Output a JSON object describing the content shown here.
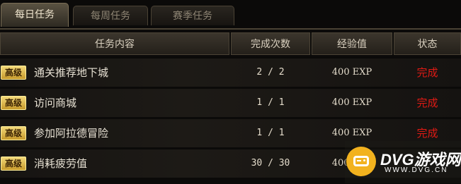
{
  "tabs": [
    {
      "label": "每日任务",
      "active": true
    },
    {
      "label": "每周任务",
      "active": false
    },
    {
      "label": "赛季任务",
      "active": false
    }
  ],
  "columns": {
    "task": "任务内容",
    "count": "完成次数",
    "exp": "经验值",
    "status": "状态"
  },
  "rows": [
    {
      "badge": "高级",
      "task": "通关推荐地下城",
      "count": "2 / 2",
      "exp": "400 EXP",
      "status": "完成"
    },
    {
      "badge": "高级",
      "task": "访问商城",
      "count": "1 / 1",
      "exp": "400 EXP",
      "status": "完成"
    },
    {
      "badge": "高级",
      "task": "参加阿拉德冒险",
      "count": "1 / 1",
      "exp": "400 EXP",
      "status": "完成"
    },
    {
      "badge": "高级",
      "task": "消耗疲劳值",
      "count": "30 / 30",
      "exp": "400 EXP",
      "status": ""
    }
  ],
  "watermark": {
    "brand": "DVG游戏网",
    "url": "WWW.DVG.CN"
  },
  "colors": {
    "status_done": "#e01a14",
    "badge": "#e7c457",
    "background": "#0b0a09"
  }
}
